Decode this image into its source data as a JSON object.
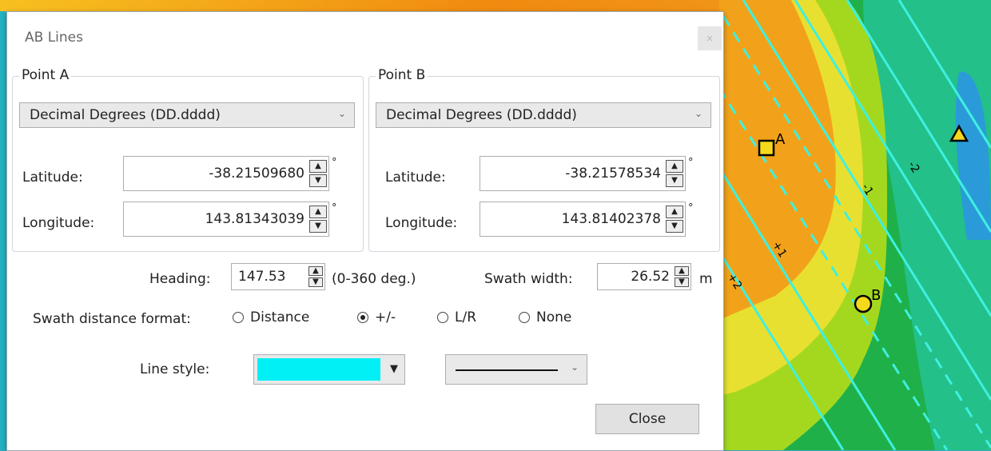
{
  "dialog": {
    "title": "AB Lines",
    "close_x": "×",
    "pointA": {
      "label": "Point A",
      "format": "Decimal Degrees (DD.dddd)",
      "lat_label": "Latitude:",
      "lat_value": "-38.21509680",
      "lon_label": "Longitude:",
      "lon_value": "143.81343039"
    },
    "pointB": {
      "label": "Point B",
      "format": "Decimal Degrees (DD.dddd)",
      "lat_label": "Latitude:",
      "lat_value": "-38.21578534",
      "lon_label": "Longitude:",
      "lon_value": "143.81402378"
    },
    "degree_symbol": "°",
    "heading_label": "Heading:",
    "heading_value": "147.53",
    "heading_unit": "(0-360 deg.)",
    "swath_label": "Swath width:",
    "swath_value": "26.52",
    "swath_unit": "m",
    "format_label": "Swath distance format:",
    "format_options": [
      "Distance",
      "+/-",
      "L/R",
      "None"
    ],
    "format_selected": "+/-",
    "line_style_label": "Line style:",
    "line_color": "#00f0f5",
    "close_button": "Close"
  },
  "map": {
    "line_labels": [
      "-2",
      "-1",
      "+1",
      "+2"
    ],
    "marker_a": "A",
    "marker_b": "B"
  }
}
